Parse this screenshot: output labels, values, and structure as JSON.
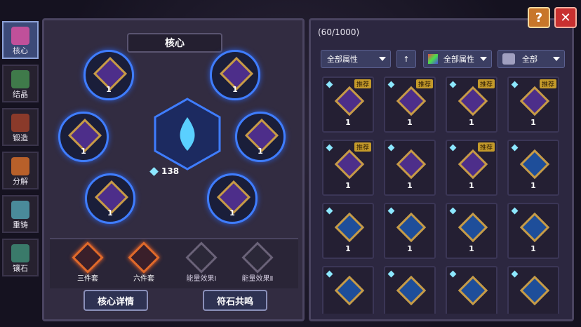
{
  "tabs": [
    {
      "label": "核心",
      "active": true
    },
    {
      "label": "结晶",
      "active": false
    },
    {
      "label": "锻造",
      "active": false
    },
    {
      "label": "分解",
      "active": false
    },
    {
      "label": "重铸",
      "active": false
    },
    {
      "label": "镶石",
      "active": false
    }
  ],
  "core": {
    "title": "核心",
    "energy_value": "138",
    "slots": [
      {
        "level": "1"
      },
      {
        "level": "1"
      },
      {
        "level": "1"
      },
      {
        "level": "1"
      },
      {
        "level": "1"
      },
      {
        "level": "1"
      }
    ],
    "sets": [
      "三件套",
      "六件套",
      "能量效果Ⅰ",
      "能量效果Ⅱ"
    ],
    "buttons": {
      "details": "核心详情",
      "resonance": "符石共鸣"
    }
  },
  "inventory": {
    "count": "(60/1000)",
    "filter1": "全部属性",
    "filter2": "全部属性",
    "filter3": "全部",
    "rec_label": "推荐",
    "items": [
      {
        "level": "1",
        "rec": true,
        "color": "purple"
      },
      {
        "level": "1",
        "rec": true,
        "color": "purple"
      },
      {
        "level": "1",
        "rec": true,
        "color": "purple"
      },
      {
        "level": "1",
        "rec": true,
        "color": "purple"
      },
      {
        "level": "1",
        "rec": true,
        "color": "purple"
      },
      {
        "level": "1",
        "rec": false,
        "color": "purple"
      },
      {
        "level": "1",
        "rec": true,
        "color": "purple"
      },
      {
        "level": "1",
        "rec": false,
        "color": "blue"
      },
      {
        "level": "1",
        "rec": false,
        "color": "blue"
      },
      {
        "level": "1",
        "rec": false,
        "color": "blue"
      },
      {
        "level": "1",
        "rec": false,
        "color": "blue"
      },
      {
        "level": "1",
        "rec": false,
        "color": "blue"
      },
      {
        "level": "",
        "rec": false,
        "color": "blue"
      },
      {
        "level": "",
        "rec": false,
        "color": "blue"
      },
      {
        "level": "",
        "rec": false,
        "color": "blue"
      },
      {
        "level": "",
        "rec": false,
        "color": "blue"
      }
    ]
  },
  "header": {
    "help": "?",
    "close": "✕"
  }
}
